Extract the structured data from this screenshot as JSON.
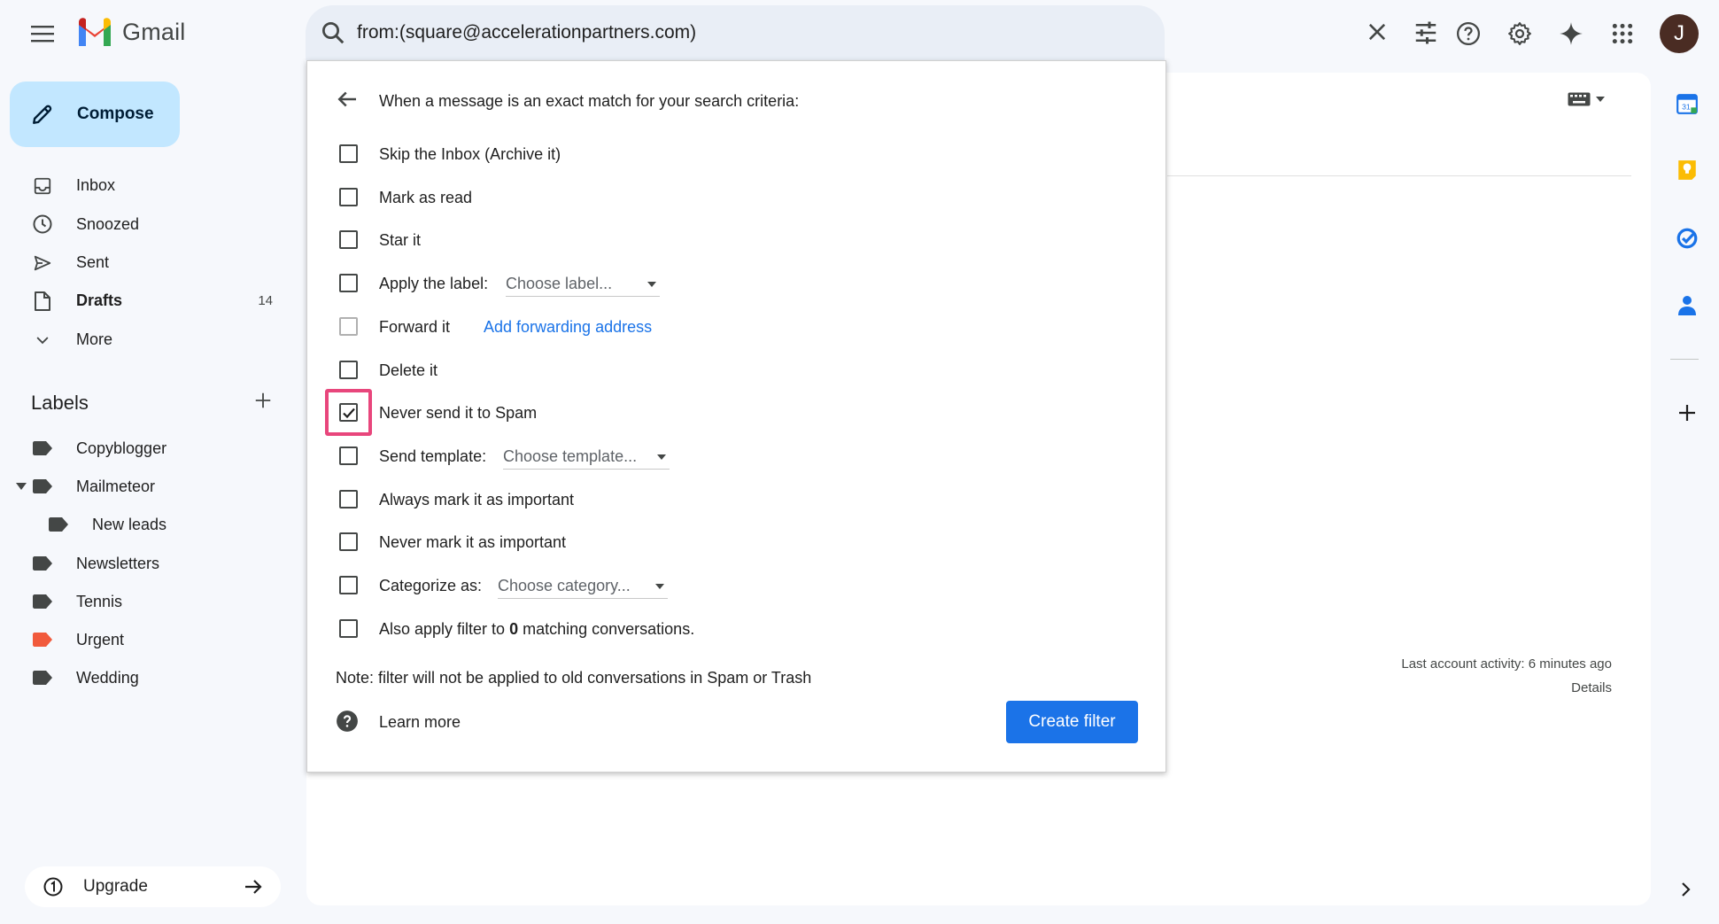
{
  "app": {
    "logo_text": "Gmail"
  },
  "search": {
    "query": "from:(square@accelerationpartners.com)"
  },
  "account": {
    "avatar_initial": "J"
  },
  "compose": {
    "label": "Compose"
  },
  "nav": {
    "items": [
      {
        "label": "Inbox",
        "count": "",
        "icon": "inbox-icon"
      },
      {
        "label": "Snoozed",
        "count": "",
        "icon": "clock-icon"
      },
      {
        "label": "Sent",
        "count": "",
        "icon": "send-icon"
      },
      {
        "label": "Drafts",
        "count": "14",
        "icon": "draft-icon"
      },
      {
        "label": "More",
        "count": "",
        "icon": "chevron-down-icon"
      }
    ]
  },
  "labels": {
    "heading": "Labels",
    "items": [
      {
        "label": "Copyblogger",
        "color": "#444746"
      },
      {
        "label": "Mailmeteor",
        "color": "#444746"
      },
      {
        "label": "New leads",
        "color": "#444746"
      },
      {
        "label": "Newsletters",
        "color": "#444746"
      },
      {
        "label": "Tennis",
        "color": "#444746"
      },
      {
        "label": "Urgent",
        "color": "#f15a3c"
      },
      {
        "label": "Wedding",
        "color": "#444746"
      }
    ]
  },
  "upgrade": {
    "label": "Upgrade"
  },
  "filter": {
    "header": "When a message is an exact match for your search criteria:",
    "options": {
      "skip_inbox": "Skip the Inbox (Archive it)",
      "mark_read": "Mark as read",
      "star": "Star it",
      "apply_label": "Apply the label:",
      "apply_label_select": "Choose label...",
      "forward": "Forward it",
      "forward_link": "Add forwarding address",
      "delete": "Delete it",
      "never_spam": "Never send it to Spam",
      "send_template": "Send template:",
      "send_template_select": "Choose template...",
      "always_important": "Always mark it as important",
      "never_important": "Never mark it as important",
      "categorize": "Categorize as:",
      "categorize_select": "Choose category...",
      "also_apply_pre": "Also apply filter to ",
      "also_apply_count": "0",
      "also_apply_post": " matching conversations."
    },
    "checked": {
      "never_spam": true
    },
    "note": "Note: filter will not be applied to old conversations in Spam or Trash",
    "learn_more": "Learn more",
    "create_button": "Create filter"
  },
  "activity": {
    "text": "Last account activity: 6 minutes ago",
    "details": "Details"
  },
  "colors": {
    "accent": "#1b73e8",
    "compose_bg": "#c2e7ff",
    "highlight": "#e8467c"
  }
}
